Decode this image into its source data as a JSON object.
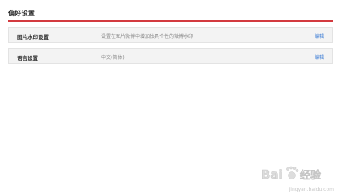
{
  "section": {
    "title": "偏好设置"
  },
  "rows": [
    {
      "label": "图片水印设置",
      "description": "设置在图片微博中增加独具个性的微博水印",
      "action": "编辑"
    },
    {
      "label": "语言设置",
      "description": "中文(简体)",
      "action": "编辑"
    }
  ],
  "colors": {
    "accent_rule": "#d33a3f",
    "link": "#3a7bd5",
    "row_bg": "#f3f3f3"
  },
  "watermark": {
    "icon": "baidu-paw-logo",
    "brand": "Bai",
    "brand_suffix": "经验",
    "url": "jingyan.baidu.com"
  }
}
